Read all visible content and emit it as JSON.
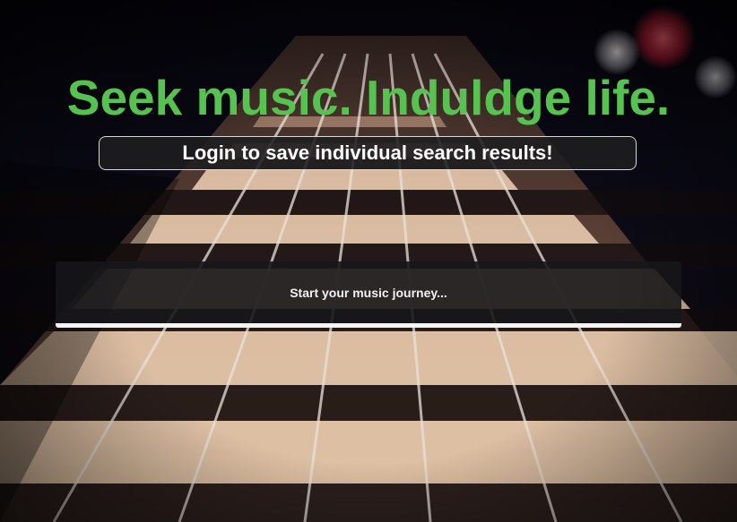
{
  "hero": {
    "headline": "Seek music. Induldge life.",
    "headline_color": "#56c24f"
  },
  "login_banner": {
    "label": "Login to save individual search results!"
  },
  "search": {
    "placeholder": "Start your music journey...",
    "value": ""
  },
  "background": {
    "image": "guitar-fretboard-photo"
  }
}
